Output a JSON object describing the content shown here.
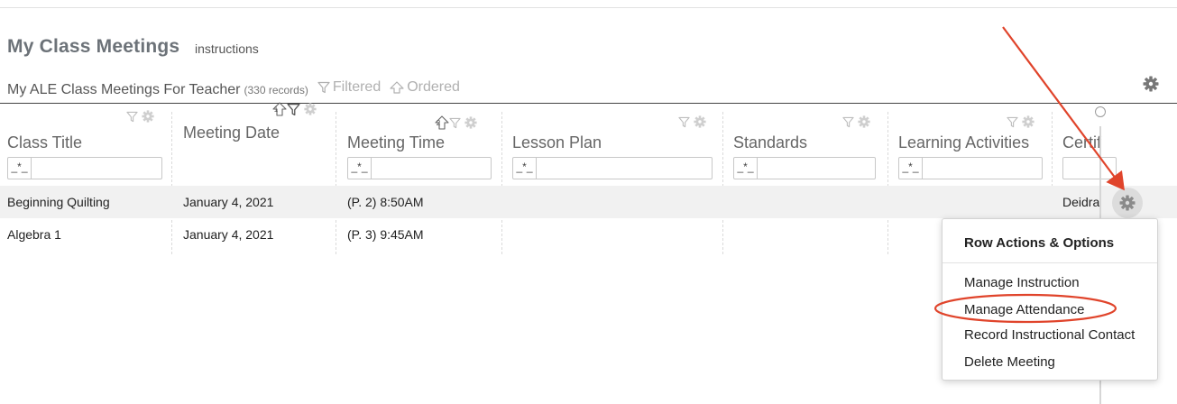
{
  "page": {
    "title": "My Class Meetings",
    "instructions_link": "instructions"
  },
  "table_header": {
    "title": "My ALE Class Meetings For Teacher",
    "record_count": "(330 records)",
    "filtered_label": "Filtered",
    "ordered_label": "Ordered"
  },
  "columns": [
    {
      "title": "Class Title",
      "filter_value": "_*_",
      "sort_order": ""
    },
    {
      "title": "Meeting Date",
      "filter_value": "",
      "sort_order": "1"
    },
    {
      "title": "Meeting Time",
      "filter_value": "_*_",
      "sort_order": "2"
    },
    {
      "title": "Lesson Plan",
      "filter_value": "_*_",
      "sort_order": ""
    },
    {
      "title": "Standards",
      "filter_value": "_*_",
      "sort_order": ""
    },
    {
      "title": "Learning Activities",
      "filter_value": "_*_",
      "sort_order": ""
    },
    {
      "title": "Certif",
      "filter_value": "",
      "sort_order": ""
    }
  ],
  "rows": [
    {
      "class_title": "Beginning Quilting",
      "meeting_date": "January 4, 2021",
      "meeting_time": "(P. 2) 8:50AM",
      "lesson_plan": "",
      "standards": "",
      "learning_activities": "",
      "certified": "Deidra"
    },
    {
      "class_title": "Algebra 1",
      "meeting_date": "January 4, 2021",
      "meeting_time": "(P. 3) 9:45AM",
      "lesson_plan": "",
      "standards": "",
      "learning_activities": "",
      "certified": ""
    }
  ],
  "row_menu": {
    "header": "Row Actions & Options",
    "items": [
      "Manage Instruction",
      "Manage Attendance",
      "Record Instructional Contact",
      "Delete Meeting"
    ],
    "highlighted_item": "Manage Attendance"
  },
  "icons": {
    "column_filter": "funnel-icon",
    "column_settings": "gear-icon",
    "table_settings": "gear-icon",
    "row_actions": "gear-icon",
    "sort": "sort-up-icon"
  },
  "colors": {
    "title_gray": "#6c7278",
    "muted_gray": "#b0b0b0",
    "row_highlight": "#f1f1f1",
    "annotation_red": "#e0442b"
  }
}
